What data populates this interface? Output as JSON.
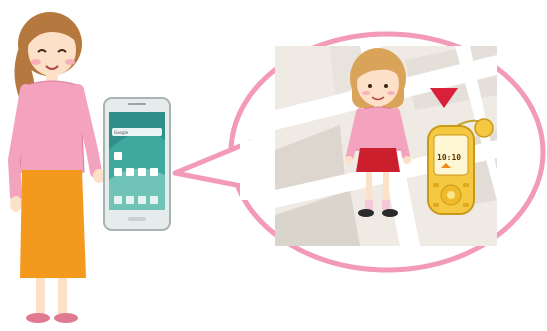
{
  "headline": "",
  "phone": {
    "search_placeholder": "Google",
    "widget_label": "",
    "status_time": ""
  },
  "gps_device": {
    "screen_time": "10:10",
    "screen_label": ""
  },
  "colors": {
    "bubble_border": "#f29ab8",
    "map_ground": "#efeae3",
    "map_road": "#ffffff",
    "map_block": "#d9d4cc",
    "pin_red": "#d8203a",
    "shirt_pink": "#f4a3bf",
    "skirt_orange": "#f39a1e",
    "skirt_red": "#cc1f2e",
    "hair_brown": "#b5783e",
    "device_gold": "#f5c842",
    "phone_body": "#e6eceb"
  },
  "icons": [
    "woman-figure",
    "smartphone-icon",
    "speech-bubble",
    "map-background",
    "girl-figure",
    "location-pin-icon",
    "gps-tracker-device"
  ]
}
